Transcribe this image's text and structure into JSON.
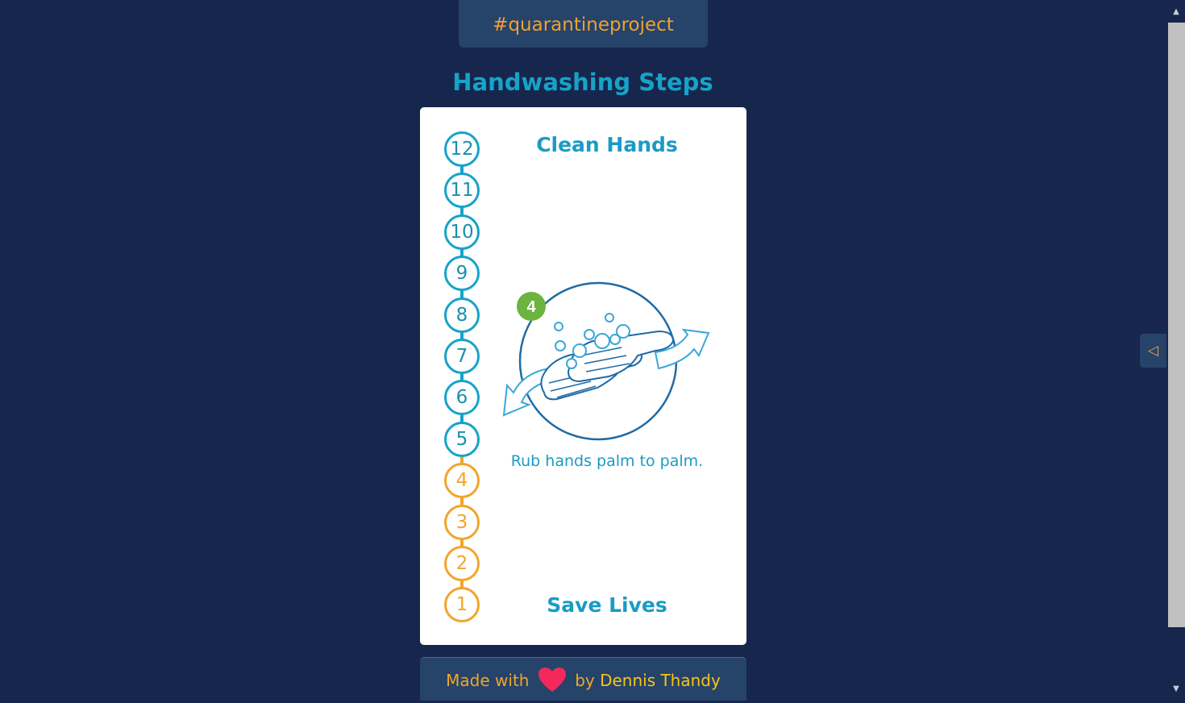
{
  "header": {
    "tagline": "#quarantineproject"
  },
  "page_title": "Handwashing Steps",
  "card": {
    "title": "Clean Hands",
    "footer": "Save Lives",
    "current_step": 4,
    "step_badge": "4",
    "caption": "Rub hands palm to palm.",
    "steps": [
      "12",
      "11",
      "10",
      "9",
      "8",
      "7",
      "6",
      "5",
      "4",
      "3",
      "2",
      "1"
    ]
  },
  "footer": {
    "made_with": "Made with",
    "by": "by",
    "author": "Dennis Thandy"
  },
  "colors": {
    "background": "#16264d",
    "panel": "#26436a",
    "accent_blue": "#16a3c8",
    "accent_orange": "#f2a52a",
    "badge_green": "#6cb33f",
    "heart": "#f2295a"
  },
  "icons": {
    "heart": "heart-icon",
    "toggle": "triangle-left-icon"
  }
}
